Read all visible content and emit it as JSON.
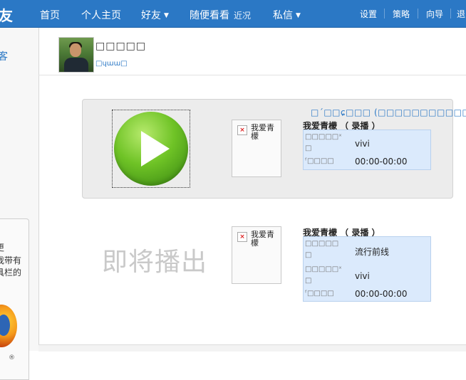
{
  "nav": {
    "logo_char": "友",
    "home": "首页",
    "profile": "个人主页",
    "friends": "好友",
    "browse": "随便看看",
    "recent": "近况",
    "messages": "私信",
    "settings": "设置",
    "strategy": "策略",
    "guide": "向导",
    "logout": "退"
  },
  "sidebar": {
    "blog_char": "客",
    "promo_lines": [
      "更",
      "我带有",
      "具栏的",
      "："
    ]
  },
  "profile": {
    "username": "□□□□□",
    "sublink": "□ɥɯɯ□"
  },
  "now_playing": {
    "on_air_label": "□´□□ɕ□□□ (□□□□□□□□□□□□)",
    "thumb_alt": "我爱青檬",
    "title": "我爱青檬 （ 录播 ）",
    "rows": [
      {
        "key": "□□□□□ˣ",
        "key2": "□",
        "value": "vivi"
      },
      {
        "key": "ᶠ□□□□",
        "key2": "",
        "value": "00:00-00:00"
      }
    ]
  },
  "upcoming": {
    "label": "即将播出",
    "thumb_alt": "我爱青檬",
    "title": "我爱青檬 （ 录播 ）",
    "rows": [
      {
        "key": "□□□□□",
        "key2": "□",
        "value": "流行前线"
      },
      {
        "key": "□□□□□ˣ",
        "key2": "□",
        "value": "vivi"
      },
      {
        "key": "ᶠ□□□□",
        "key2": "",
        "value": "00:00-00:00"
      }
    ]
  },
  "colors": {
    "nav_bg": "#2b78c5",
    "info_bg": "#dbeafc",
    "card_bg": "#ececec",
    "play_green": "#6fc326"
  },
  "icons": {
    "play": "play-icon",
    "broken_image": "broken-image-icon",
    "dropdown": "caret-down-icon"
  }
}
